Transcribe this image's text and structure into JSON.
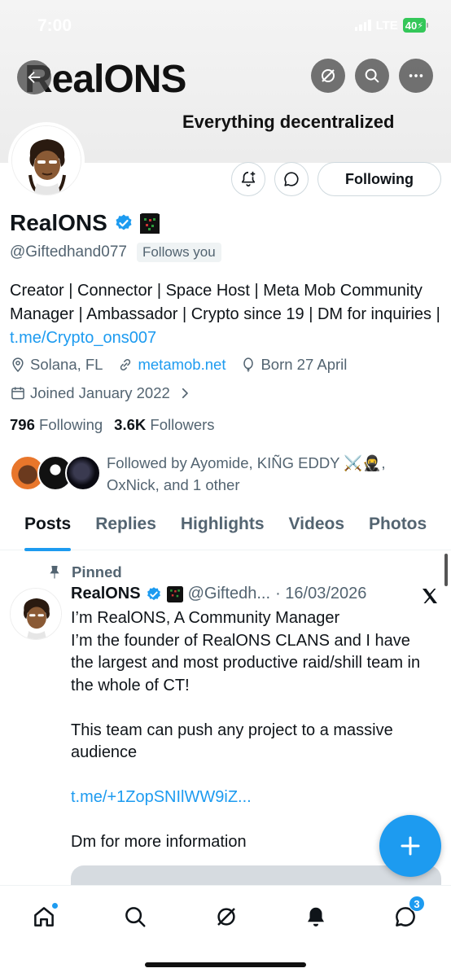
{
  "status_bar": {
    "time": "7:00",
    "network": "LTE",
    "battery": "40"
  },
  "banner": {
    "logo_text": "RealONS",
    "tagline": "Everything decentralized"
  },
  "profile": {
    "display_name": "RealONS",
    "handle": "@Giftedhand077",
    "follows_you": "Follows you",
    "following_button": "Following",
    "bio_text": "Creator | Connector | Space Host | Meta Mob Community Manager | Ambassador | Crypto since 19 | DM for inquiries | ",
    "bio_link": "t.me/Crypto_ons007",
    "location": "Solana, FL",
    "website": "metamob.net",
    "born": "Born 27 April",
    "joined": "Joined January 2022",
    "following_count": "796",
    "following_label": "Following",
    "followers_count": "3.6K",
    "followers_label": "Followers",
    "followed_by": "Followed by Ayomide, KIÑG EDDY ⚔️🥷, OxNick, and 1 other"
  },
  "tabs": [
    "Posts",
    "Replies",
    "Highlights",
    "Videos",
    "Photos"
  ],
  "pinned_post": {
    "pinned_label": "Pinned",
    "author": "RealONS",
    "handle": "@Giftedh...",
    "date": "· 16/03/2026",
    "lines": [
      "I’m RealONS, A Community Manager",
      "I’m the founder of RealONS CLANS and I have the largest and most productive raid/shill team in the whole of CT!",
      "",
      "This team can push any project to a massive audience",
      "",
      "t.me/+1ZopSNIlWW9iZ...",
      "",
      "Dm for more information"
    ]
  },
  "bottom_nav": {
    "messages_badge": "3"
  },
  "colors": {
    "accent": "#1d9bf0",
    "text": "#0f1419",
    "secondary": "#536471"
  }
}
